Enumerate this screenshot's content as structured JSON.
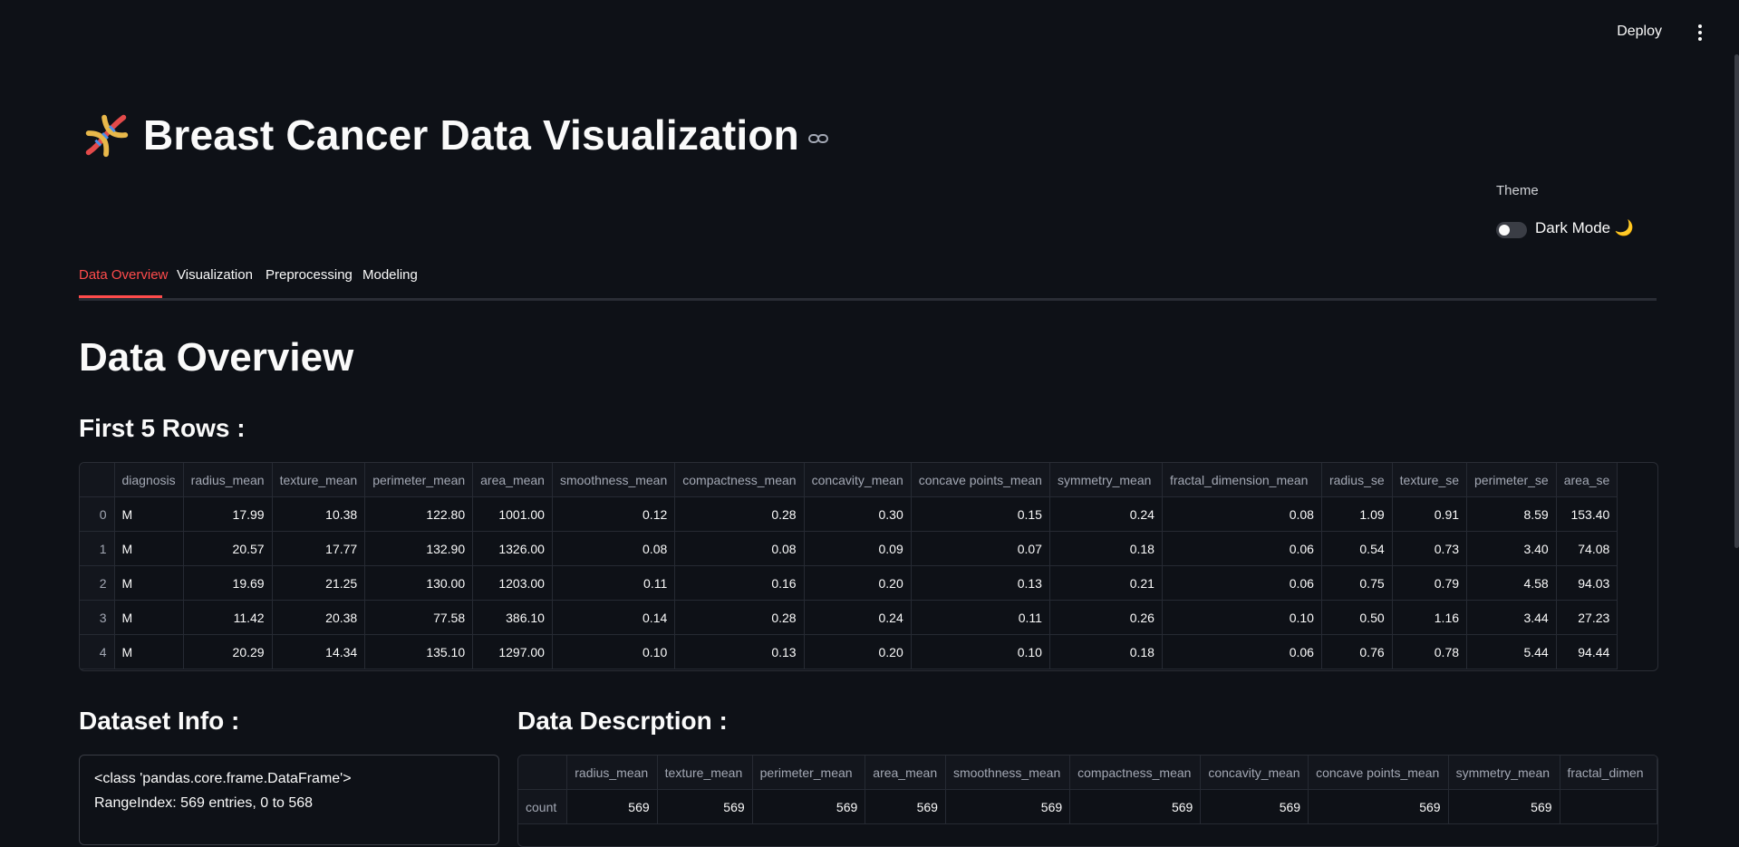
{
  "header": {
    "deploy_label": "Deploy",
    "menu_icon": "kebab-menu-icon"
  },
  "title": {
    "icon": "dna-icon",
    "text": "Breast Cancer Data Visualization",
    "link_icon": "link-icon"
  },
  "theme": {
    "label": "Theme",
    "toggle_label": "Dark Mode 🌙",
    "toggle_on": false
  },
  "tabs": [
    {
      "label": "Data Overview",
      "active": true
    },
    {
      "label": "Visualization",
      "active": false
    },
    {
      "label": "Preprocessing",
      "active": false
    },
    {
      "label": "Modeling",
      "active": false
    }
  ],
  "main": {
    "heading": "Data Overview",
    "first_rows_heading": "First 5 Rows :",
    "dataset_info_heading": "Dataset Info :",
    "description_heading": "Data Descrption :"
  },
  "first_rows_table": {
    "columns": [
      "",
      "diagnosis",
      "radius_mean",
      "texture_mean",
      "perimeter_mean",
      "area_mean",
      "smoothness_mean",
      "compactness_mean",
      "concavity_mean",
      "concave points_mean",
      "symmetry_mean",
      "fractal_dimension_mean",
      "radius_se",
      "texture_se",
      "perimeter_se",
      "area_se"
    ],
    "rows": [
      [
        "0",
        "M",
        "17.99",
        "10.38",
        "122.80",
        "1001.00",
        "0.12",
        "0.28",
        "0.30",
        "0.15",
        "0.24",
        "0.08",
        "1.09",
        "0.91",
        "8.59",
        "153.40"
      ],
      [
        "1",
        "M",
        "20.57",
        "17.77",
        "132.90",
        "1326.00",
        "0.08",
        "0.08",
        "0.09",
        "0.07",
        "0.18",
        "0.06",
        "0.54",
        "0.73",
        "3.40",
        "74.08"
      ],
      [
        "2",
        "M",
        "19.69",
        "21.25",
        "130.00",
        "1203.00",
        "0.11",
        "0.16",
        "0.20",
        "0.13",
        "0.21",
        "0.06",
        "0.75",
        "0.79",
        "4.58",
        "94.03"
      ],
      [
        "3",
        "M",
        "11.42",
        "20.38",
        "77.58",
        "386.10",
        "0.14",
        "0.28",
        "0.24",
        "0.11",
        "0.26",
        "0.10",
        "0.50",
        "1.16",
        "3.44",
        "27.23"
      ],
      [
        "4",
        "M",
        "20.29",
        "14.34",
        "135.10",
        "1297.00",
        "0.10",
        "0.13",
        "0.20",
        "0.10",
        "0.18",
        "0.06",
        "0.76",
        "0.78",
        "5.44",
        "94.44"
      ]
    ]
  },
  "dataset_info": {
    "lines": [
      "<class 'pandas.core.frame.DataFrame'>",
      "RangeIndex: 569 entries, 0 to 568"
    ]
  },
  "description_table": {
    "columns": [
      "",
      "radius_mean",
      "texture_mean",
      "perimeter_mean",
      "area_mean",
      "smoothness_mean",
      "compactness_mean",
      "concavity_mean",
      "concave points_mean",
      "symmetry_mean",
      "fractal_dimen"
    ],
    "rows": [
      [
        "count",
        "569",
        "569",
        "569",
        "569",
        "569",
        "569",
        "569",
        "569",
        "569",
        ""
      ]
    ]
  },
  "colors": {
    "background": "#0e1117",
    "accent": "#ff4b4b",
    "text": "#fafafa",
    "muted": "#a3a8b4"
  }
}
